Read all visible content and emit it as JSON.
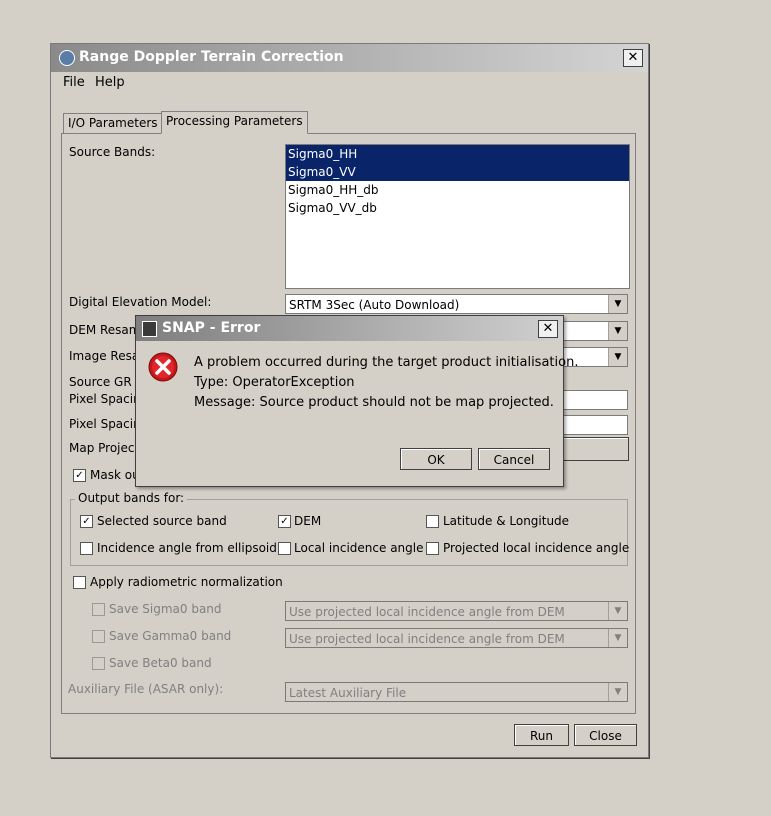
{
  "window": {
    "title": "Range Doppler Terrain Correction"
  },
  "menu": {
    "file": "File",
    "help": "Help"
  },
  "tabs": [
    {
      "label": "I/O Parameters",
      "active": false
    },
    {
      "label": "Processing Parameters",
      "active": true
    }
  ],
  "form": {
    "source_bands_label": "Source Bands:",
    "source_bands": [
      {
        "name": "Sigma0_HH",
        "selected": true
      },
      {
        "name": "Sigma0_VV",
        "selected": true
      },
      {
        "name": "Sigma0_HH_db",
        "selected": false
      },
      {
        "name": "Sigma0_VV_db",
        "selected": false
      }
    ],
    "dem_label": "Digital Elevation Model:",
    "dem_value": "SRTM 3Sec (Auto Download)",
    "dem_resampling_label": "DEM Resam",
    "image_resampling_label": "Image Resa",
    "source_gr_label": "Source GR",
    "pixel_spacing_m_label": "Pixel Spacin",
    "pixel_spacing_deg_label": "Pixel Spacin",
    "map_projection_label": "Map Projec",
    "mask_label": "Mask ou",
    "mask_checked": true
  },
  "output_bands": {
    "group_label": "Output bands for:",
    "items": [
      {
        "label": "Selected source band",
        "checked": true
      },
      {
        "label": "DEM",
        "checked": true
      },
      {
        "label": "Latitude & Longitude",
        "checked": false
      },
      {
        "label": "Incidence angle from ellipsoid",
        "checked": false
      },
      {
        "label": "Local incidence angle",
        "checked": false
      },
      {
        "label": "Projected local incidence angle",
        "checked": false
      }
    ]
  },
  "radiometric": {
    "apply_label": "Apply radiometric normalization",
    "apply_checked": false,
    "save_sigma0_label": "Save Sigma0 band",
    "save_sigma0_value": "Use projected local incidence angle from DEM",
    "save_gamma0_label": "Save Gamma0 band",
    "save_gamma0_value": "Use projected local incidence angle from DEM",
    "save_beta0_label": "Save Beta0 band",
    "aux_file_label": "Auxiliary File (ASAR only):",
    "aux_file_value": "Latest Auxiliary File"
  },
  "buttons": {
    "run": "Run",
    "close": "Close"
  },
  "error_dialog": {
    "title": "SNAP - Error",
    "line1": "A problem occurred during the target product initialisation.",
    "line2": "Type: OperatorException",
    "line3": "Message: Source product should not be map projected.",
    "ok": "OK",
    "cancel": "Cancel"
  },
  "icons": {
    "close": "close-icon",
    "error": "error-icon",
    "dropdown": "chevron-down-icon"
  }
}
